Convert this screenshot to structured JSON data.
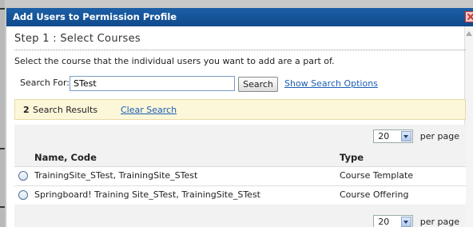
{
  "dialog": {
    "title": "Add Users to Permission Profile",
    "step_title": "Step 1 : Select Courses",
    "instructions": "Select the course that the individual users you want to add are a part of.",
    "search": {
      "label": "Search For:",
      "value": "STest",
      "button_label": "Search",
      "show_options_label": "Show Search Options"
    },
    "results": {
      "count": "2",
      "label": "Search Results",
      "clear_label": "Clear Search"
    },
    "pager": {
      "per_page_value": "20",
      "per_page_label": "per page"
    },
    "table": {
      "columns": [
        "Name, Code",
        "Type"
      ],
      "rows": [
        {
          "name": "TrainingSite_STest, TrainingSite_STest",
          "type": "Course Template"
        },
        {
          "name": "Springboard! Training Site_STest, TrainingSite_STest",
          "type": "Course Offering"
        }
      ]
    }
  },
  "icons": {
    "close": "close-icon",
    "scroll_up": "arrow-up-icon",
    "dropdown": "chevron-down-icon",
    "radio": "radio-icon"
  },
  "colors": {
    "titlebar": "#0f4a8c",
    "link": "#1a5fb4",
    "results_bg": "#fdf7da"
  }
}
